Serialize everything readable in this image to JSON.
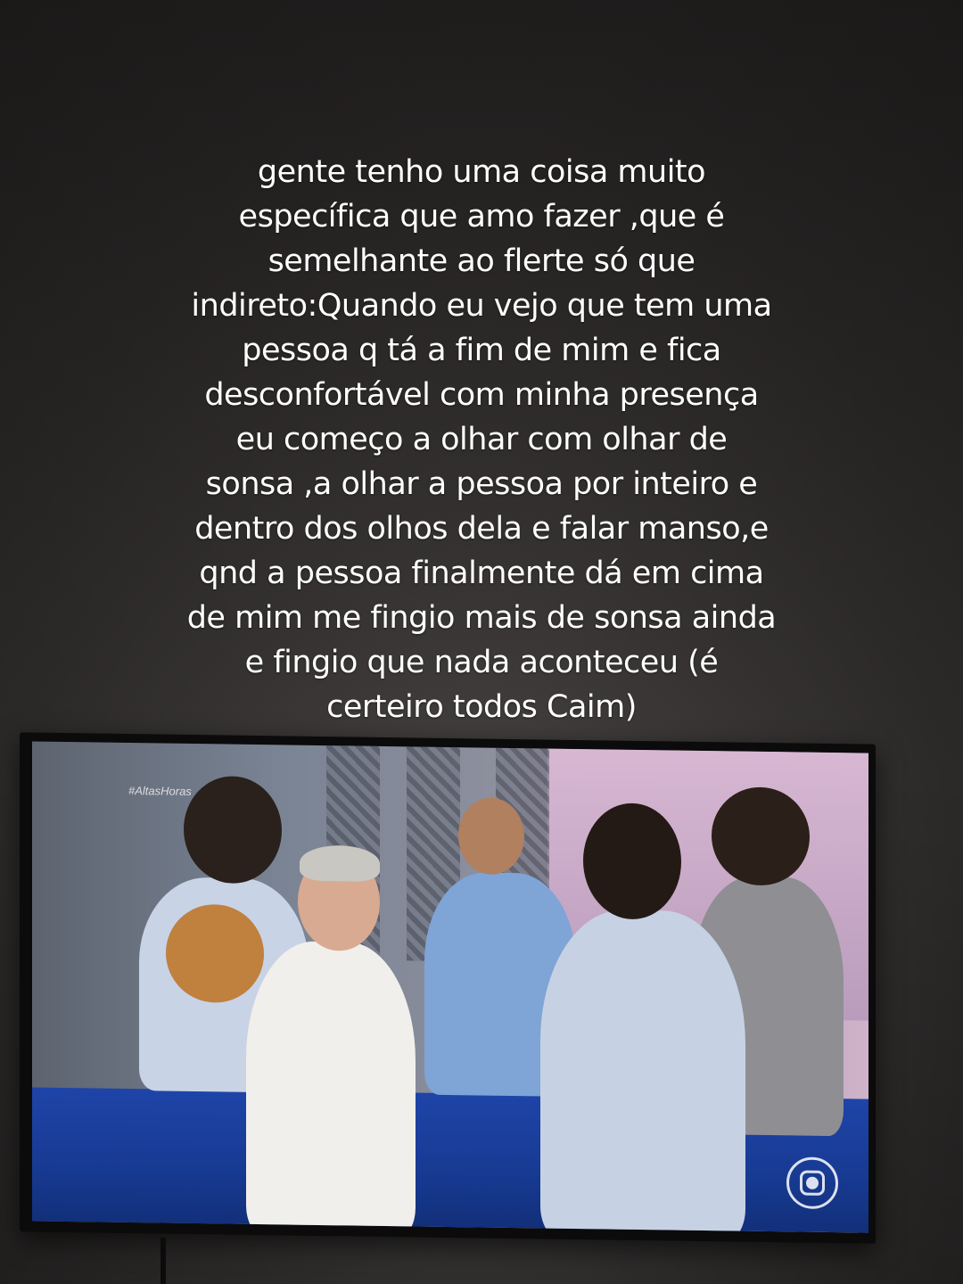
{
  "caption": {
    "lines": [
      "gente tenho uma coisa muito",
      "específica que amo fazer ,que é",
      "semelhante ao flerte só que",
      "indireto:Quando eu vejo que tem uma",
      "pessoa q tá a fim de mim e fica",
      "desconfortável com minha presença",
      "eu começo a olhar com olhar de",
      "sonsa ,a olhar a pessoa por inteiro e",
      "dentro dos olhos dela e falar manso,e",
      "qnd a pessoa finalmente dá em cima",
      "de mim me fingio mais de sonsa ainda",
      "e fingio que nada aconteceu (é",
      "certeiro todos Caim)"
    ]
  },
  "tv": {
    "watermark": "#AltasHoras",
    "logo_icon": "globo-logo-icon"
  },
  "colors": {
    "background": "#2e2b2a",
    "caption_text": "#ffffff",
    "stage_floor": "#1e44a8"
  }
}
